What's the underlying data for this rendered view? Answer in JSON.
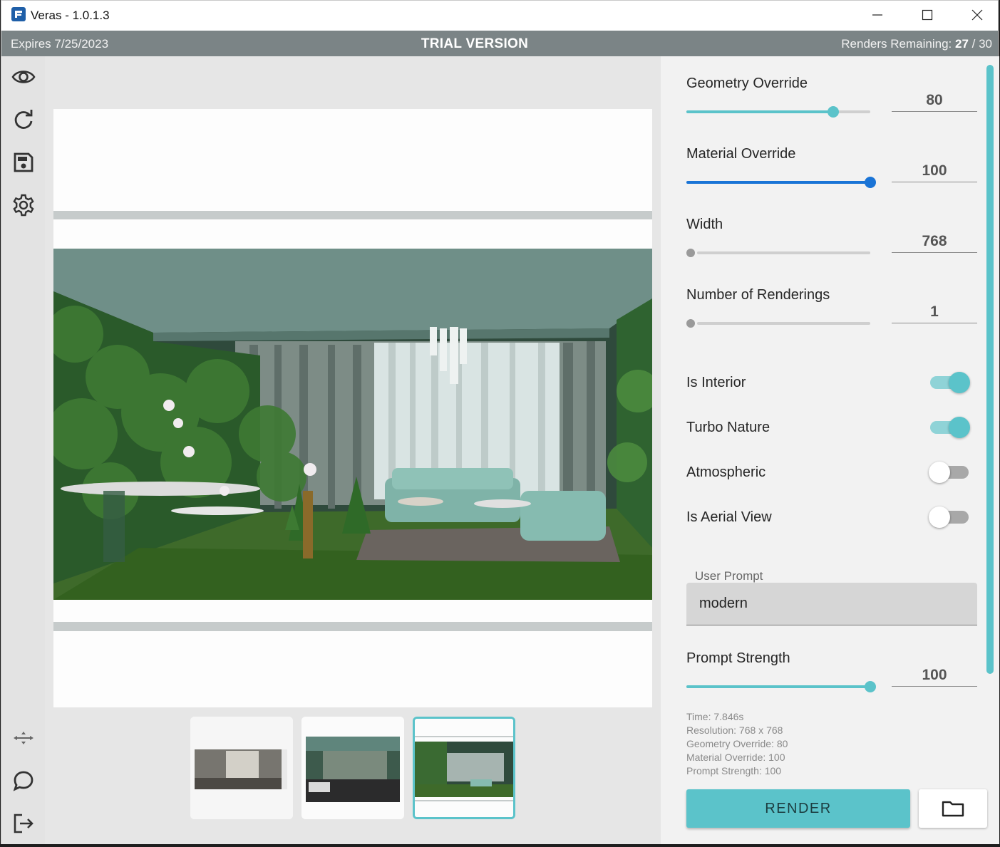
{
  "window": {
    "title": "Veras - 1.0.1.3",
    "controls": [
      "minimize-icon",
      "maximize-icon",
      "close-icon"
    ]
  },
  "trial_bar": {
    "expires": "Expires 7/25/2023",
    "label": "TRIAL VERSION",
    "renders_label": "Renders Remaining:",
    "renders_used": "27",
    "renders_sep": " / ",
    "renders_total": "30"
  },
  "toolbar": {
    "top": [
      "eye-icon",
      "refresh-icon",
      "save-icon",
      "gear-icon"
    ],
    "bottom": [
      "move-arrows-icon",
      "chat-icon",
      "logout-icon"
    ]
  },
  "settings": {
    "geometry_override": {
      "label": "Geometry Override",
      "value": "80",
      "level": 0.8
    },
    "material_override": {
      "label": "Material Override",
      "value": "100",
      "level": 1.0
    },
    "width": {
      "label": "Width",
      "value": "768",
      "level": 0.0
    },
    "num_renderings": {
      "label": "Number of Renderings",
      "value": "1",
      "level": 0.0
    },
    "is_interior": {
      "label": "Is Interior",
      "on": true
    },
    "turbo_nature": {
      "label": "Turbo Nature",
      "on": true
    },
    "atmospheric": {
      "label": "Atmospheric",
      "on": false
    },
    "is_aerial_view": {
      "label": "Is Aerial View",
      "on": false
    },
    "user_prompt": {
      "label": "User Prompt",
      "value": "modern"
    },
    "prompt_strength": {
      "label": "Prompt Strength",
      "value": "100",
      "level": 1.0
    }
  },
  "info": {
    "time": "Time: 7.846s",
    "resolution": "Resolution: 768 x 768",
    "geometry": "Geometry Override: 80",
    "material": "Material Override: 100",
    "prompt_strength": "Prompt Strength: 100"
  },
  "actions": {
    "render_label": "RENDER",
    "folder_icon": "folder-icon"
  },
  "thumbnails": {
    "count": 3,
    "selected_index": 2
  },
  "colors": {
    "accent": "#5bc3ca",
    "blue": "#1a74d6",
    "trial_bar": "#7b8486"
  }
}
